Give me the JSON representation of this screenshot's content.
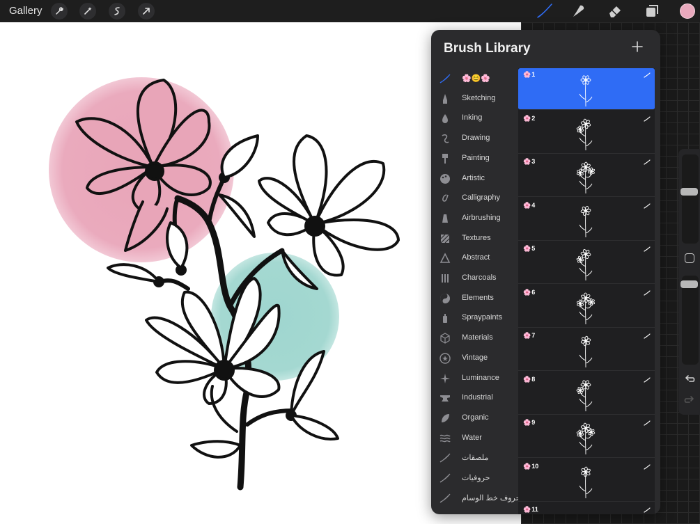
{
  "topbar": {
    "gallery_label": "Gallery",
    "actions": [
      "wrench-icon",
      "magic-wand-icon",
      "selection-icon",
      "transform-arrow-icon"
    ],
    "tools": [
      "brush-icon",
      "smudge-icon",
      "eraser-icon",
      "layers-icon"
    ],
    "current_color": "#e9a9bd"
  },
  "library": {
    "title": "Brush Library",
    "sets": [
      {
        "label": "🌸😊🌸",
        "icon": "brush-stroke-icon",
        "active": true
      },
      {
        "label": "Sketching",
        "icon": "pencil-icon"
      },
      {
        "label": "Inking",
        "icon": "ink-drop-icon"
      },
      {
        "label": "Drawing",
        "icon": "squiggle-icon"
      },
      {
        "label": "Painting",
        "icon": "paintbrush-icon"
      },
      {
        "label": "Artistic",
        "icon": "palette-icon"
      },
      {
        "label": "Calligraphy",
        "icon": "calligraphy-icon"
      },
      {
        "label": "Airbrushing",
        "icon": "airbrush-icon"
      },
      {
        "label": "Textures",
        "icon": "texture-icon"
      },
      {
        "label": "Abstract",
        "icon": "triangle-icon"
      },
      {
        "label": "Charcoals",
        "icon": "charcoal-icon"
      },
      {
        "label": "Elements",
        "icon": "yin-yang-icon"
      },
      {
        "label": "Spraypaints",
        "icon": "spray-can-icon"
      },
      {
        "label": "Materials",
        "icon": "cube-icon"
      },
      {
        "label": "Vintage",
        "icon": "star-badge-icon"
      },
      {
        "label": "Luminance",
        "icon": "sparkle-icon"
      },
      {
        "label": "Industrial",
        "icon": "anvil-icon"
      },
      {
        "label": "Organic",
        "icon": "leaf-icon"
      },
      {
        "label": "Water",
        "icon": "waves-icon"
      },
      {
        "label": "ملصقات",
        "icon": "brush-stroke-icon"
      },
      {
        "label": "حروفيات",
        "icon": "brush-stroke-icon"
      },
      {
        "label": "حروف خط الوسام",
        "icon": "brush-stroke-icon"
      }
    ],
    "brushes": [
      {
        "number": "1",
        "selected": true
      },
      {
        "number": "2"
      },
      {
        "number": "3"
      },
      {
        "number": "4"
      },
      {
        "number": "5"
      },
      {
        "number": "6"
      },
      {
        "number": "7"
      },
      {
        "number": "8"
      },
      {
        "number": "9"
      },
      {
        "number": "10"
      },
      {
        "number": "11"
      }
    ],
    "flower_glyph": "🌸"
  },
  "colors": {
    "accent": "#2f6cf5",
    "pink_circle": "#e8a5b8",
    "teal_circle": "#9fd6cf"
  }
}
